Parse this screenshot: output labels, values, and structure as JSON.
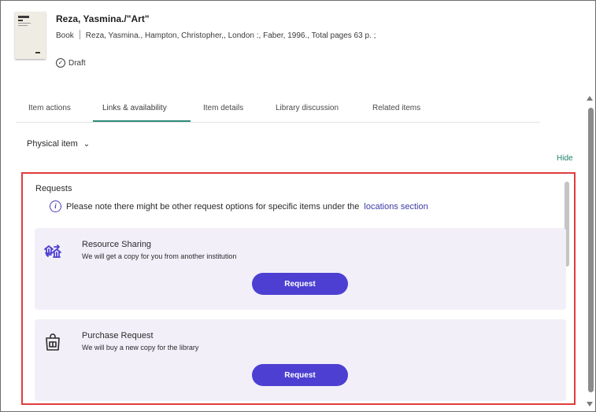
{
  "record": {
    "title": "Reza, Yasmina./\"Art\"",
    "type": "Book",
    "details": "Reza, Yasmina., Hampton, Christopher,, London :, Faber, 1996., Total pages 63 p. ;",
    "status": "Draft"
  },
  "tabs": [
    {
      "label": "Item actions"
    },
    {
      "label": "Links & availability"
    },
    {
      "label": "Item details"
    },
    {
      "label": "Library discussion"
    },
    {
      "label": "Related items"
    }
  ],
  "active_tab": "Links & availability",
  "physical_item": {
    "label": "Physical item",
    "chevron": "chevron-down-icon"
  },
  "hide_label": "Hide",
  "requests": {
    "heading": "Requests",
    "note_text": "Please note there might be other request options for specific items under the",
    "note_link": "locations section",
    "cards": [
      {
        "icon": "resource-sharing-icon",
        "title": "Resource Sharing",
        "subtitle": "We will get a copy for you from another institution",
        "button": "Request"
      },
      {
        "icon": "purchase-bag-icon",
        "title": "Purchase Request",
        "subtitle": "We will buy a new copy for the library",
        "button": "Request"
      }
    ]
  },
  "colors": {
    "accent": "#4c3fd1",
    "tab_underline": "#2e8b7a",
    "highlight_border": "#e03c3c",
    "card_bg": "#f2eff9",
    "link": "#3c3aa8"
  }
}
